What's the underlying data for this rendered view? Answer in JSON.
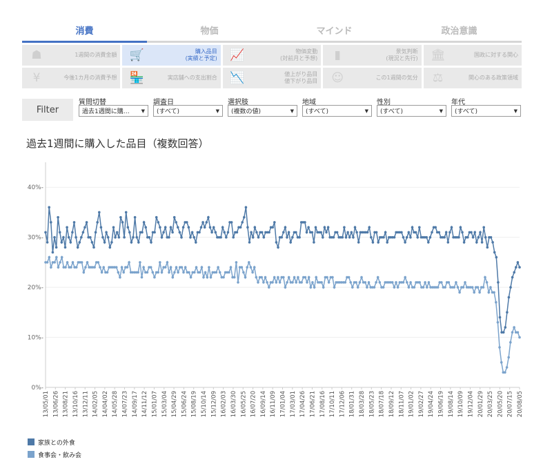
{
  "tabs": [
    {
      "label": "消費",
      "active": true
    },
    {
      "label": "物価",
      "active": false
    },
    {
      "label": "マインド",
      "active": false
    },
    {
      "label": "政治意識",
      "active": false
    }
  ],
  "grid": [
    [
      {
        "icon": "☗",
        "label": "1週間の消費金額"
      },
      {
        "icon": "🛒",
        "label": "購入品目\n(実績と予定)",
        "active": true
      },
      {
        "icon": "📈",
        "label": "物価変動\n(対前月と予想)"
      },
      {
        "icon": "▮",
        "label": "景気判断\n(現況と先行)"
      },
      {
        "icon": "🏛",
        "label": "国政に対する関心"
      }
    ],
    [
      {
        "icon": "¥",
        "label": "今後1カ月の消費予想"
      },
      {
        "icon": "🏪",
        "label": "実店舗への支出割合"
      },
      {
        "icon": "📉",
        "label": "値上がり品目\n値下がり品目"
      },
      {
        "icon": "☺",
        "label": "この1週間の気分"
      },
      {
        "icon": "⚖",
        "label": "関心のある政策領域"
      }
    ]
  ],
  "filter": {
    "button": "Filter",
    "fields": [
      {
        "label": "質問切替",
        "value": "過去1週間に購…"
      },
      {
        "label": "調査日",
        "value": "(すべて)"
      },
      {
        "label": "選択肢",
        "value": "(複数の値)"
      },
      {
        "label": "地域",
        "value": "(すべて)"
      },
      {
        "label": "性別",
        "value": "(すべて)"
      },
      {
        "label": "年代",
        "value": "(すべて)"
      }
    ]
  },
  "colors": {
    "series1": "#4e79a7",
    "series2": "#7ba3cc",
    "accent": "#4472c4"
  },
  "chart_data": {
    "type": "line",
    "title": "過去1週間に購入した品目（複数回答）",
    "ylim": [
      0,
      45
    ],
    "yticks": [
      "0%",
      "10%",
      "20%",
      "30%",
      "40%"
    ],
    "xticks": [
      "13/05/01",
      "13/06/26",
      "13/08/21",
      "13/10/16",
      "13/12/11",
      "14/02/05",
      "14/04/02",
      "14/05/28",
      "14/07/23",
      "14/09/17",
      "14/11/12",
      "15/01/07",
      "15/03/04",
      "15/04/29",
      "15/06/24",
      "15/08/19",
      "15/10/14",
      "15/12/09",
      "16/02/03",
      "16/03/30",
      "16/05/25",
      "16/07/20",
      "16/09/14",
      "16/11/09",
      "17/01/04",
      "17/03/01",
      "17/04/26",
      "17/06/21",
      "17/08/16",
      "17/10/11",
      "17/12/06",
      "18/01/31",
      "18/03/28",
      "18/05/23",
      "18/07/18",
      "18/09/12",
      "18/11/07",
      "19/01/02",
      "19/02/27",
      "19/04/24",
      "19/06/19",
      "19/08/14",
      "19/10/09",
      "19/12/04",
      "20/01/29",
      "20/03/25",
      "20/05/20",
      "20/07/15",
      "20/08/05"
    ],
    "legend_position": "bottom-left",
    "series": [
      {
        "name": "家族との外食",
        "values": [
          31,
          29,
          36,
          33,
          27,
          30,
          28,
          34,
          31,
          29,
          30,
          28,
          32,
          30,
          29,
          31,
          33,
          30,
          28,
          29,
          30,
          31,
          32,
          33,
          30,
          30,
          29,
          28,
          31,
          33,
          35,
          32,
          30,
          29,
          31,
          30,
          28,
          29,
          32,
          30,
          31,
          30,
          34,
          33,
          30,
          35,
          32,
          31,
          29,
          30,
          34,
          30,
          29,
          31,
          31,
          33,
          32,
          30,
          30,
          29,
          31,
          31,
          34,
          33,
          32,
          30,
          31,
          32,
          30,
          30,
          32,
          31,
          34,
          33,
          32,
          31,
          30,
          32,
          33,
          33,
          32,
          30,
          31,
          30,
          29,
          31,
          31,
          32,
          33,
          32,
          33,
          34,
          32,
          31,
          32,
          31,
          30,
          30,
          30,
          32,
          31,
          30,
          31,
          33,
          33,
          30,
          31,
          31,
          32,
          32,
          33,
          34,
          36,
          32,
          29,
          31,
          30,
          32,
          31,
          30,
          31,
          31,
          30,
          31,
          31,
          31,
          32,
          32,
          33,
          29,
          28,
          30,
          30,
          31,
          32,
          30,
          31,
          29,
          30,
          31,
          31,
          30,
          30,
          33,
          33,
          33,
          31,
          32,
          31,
          31,
          29,
          32,
          31,
          31,
          31,
          30,
          32,
          31,
          32,
          30,
          30,
          30,
          31,
          31,
          30,
          30,
          30,
          32,
          30,
          31,
          30,
          31,
          30,
          32,
          31,
          29,
          31,
          31,
          31,
          31,
          31,
          32,
          30,
          29,
          31,
          31,
          29,
          30,
          30,
          30,
          31,
          29,
          30,
          30,
          30,
          30,
          31,
          31,
          31,
          31,
          30,
          29,
          30,
          31,
          30,
          32,
          31,
          31,
          30,
          32,
          30,
          30,
          30,
          30,
          29,
          30,
          31,
          32,
          32,
          31,
          31,
          30,
          30,
          30,
          31,
          29,
          31,
          32,
          30,
          30,
          30,
          30,
          32,
          31,
          29,
          30,
          30,
          31,
          31,
          30,
          31,
          29,
          30,
          31,
          29,
          32,
          30,
          28,
          30,
          30,
          29,
          27,
          26,
          21,
          14,
          11,
          11,
          12,
          15,
          18,
          20,
          22,
          23,
          24,
          25,
          24
        ],
        "color": "#4e79a7"
      },
      {
        "name": "食事会・飲み会",
        "values": [
          25,
          25,
          26,
          24,
          25,
          25,
          26,
          24,
          25,
          26,
          24,
          24,
          25,
          24,
          24,
          25,
          24,
          24,
          25,
          25,
          25,
          23,
          24,
          25,
          24,
          24,
          24,
          24,
          25,
          25,
          24,
          23,
          24,
          23,
          23,
          24,
          24,
          24,
          24,
          24,
          23,
          22,
          24,
          23,
          24,
          24,
          25,
          23,
          23,
          23,
          23,
          23,
          25,
          22,
          24,
          23,
          23,
          24,
          24,
          23,
          22,
          23,
          23,
          25,
          23,
          24,
          24,
          25,
          23,
          24,
          22,
          23,
          24,
          23,
          24,
          24,
          23,
          24,
          23,
          23,
          22,
          23,
          23,
          24,
          23,
          23,
          24,
          22,
          23,
          22,
          24,
          22,
          23,
          23,
          23,
          24,
          23,
          22,
          22,
          23,
          23,
          23,
          24,
          22,
          22,
          25,
          21,
          24,
          24,
          23,
          22,
          24,
          25,
          24,
          23,
          24,
          22,
          21,
          22,
          22,
          21,
          22,
          21,
          20,
          21,
          21,
          22,
          21,
          22,
          21,
          22,
          22,
          20,
          21,
          22,
          21,
          21,
          22,
          21,
          22,
          21,
          21,
          22,
          22,
          21,
          22,
          20,
          21,
          20,
          22,
          21,
          21,
          21,
          20,
          22,
          22,
          21,
          22,
          22,
          20,
          21,
          21,
          21,
          21,
          21,
          21,
          22,
          22,
          21,
          20,
          21,
          21,
          20,
          21,
          22,
          21,
          21,
          20,
          21,
          20,
          20,
          20,
          21,
          22,
          21,
          20,
          20,
          21,
          21,
          21,
          21,
          21,
          20,
          21,
          20,
          21,
          21,
          21,
          22,
          21,
          20,
          21,
          20,
          20,
          21,
          21,
          21,
          20,
          20,
          21,
          20,
          21,
          20,
          20,
          20,
          20,
          20,
          21,
          21,
          20,
          20,
          21,
          21,
          20,
          20,
          20,
          21,
          20,
          19,
          20,
          20,
          21,
          20,
          20,
          20,
          20,
          19,
          20,
          20,
          19,
          20,
          20,
          22,
          21,
          19,
          20,
          19,
          19,
          17,
          13,
          8,
          5,
          3,
          3,
          4,
          6,
          9,
          11,
          12,
          11,
          11,
          10
        ],
        "color": "#7ba3cc"
      }
    ]
  }
}
